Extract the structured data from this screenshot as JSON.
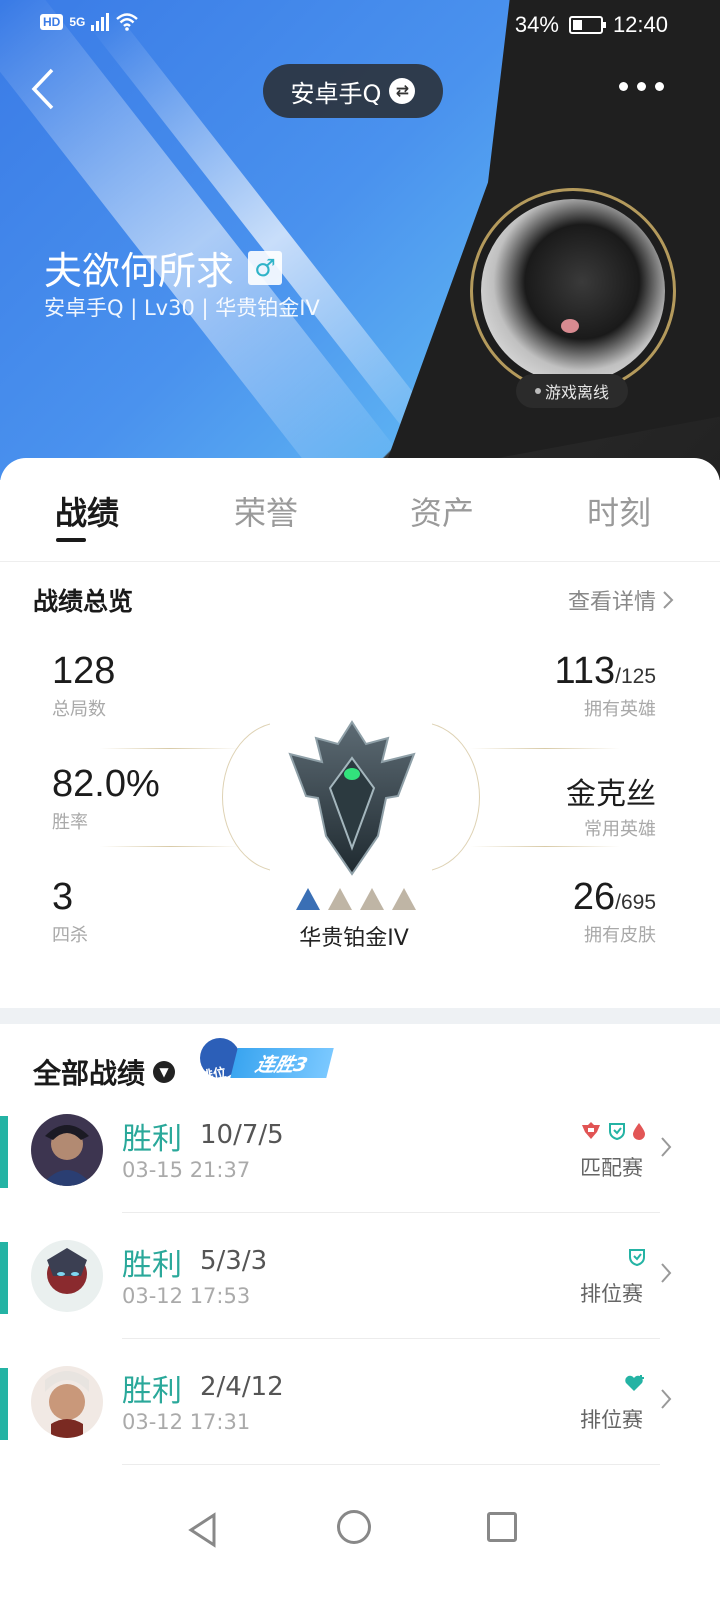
{
  "status_bar": {
    "hd": "HD",
    "network": "5G",
    "battery_percent": "34%",
    "battery_level": 0.34,
    "time": "12:40"
  },
  "header": {
    "account_switch_label": "安卓手Q",
    "nickname": "夫欲何所求",
    "gender_symbol": "♂",
    "sub_info": "安卓手Q | Lv30 | 华贵铂金IV",
    "online_status": "游戏离线"
  },
  "tabs": [
    {
      "label": "战绩",
      "active": true
    },
    {
      "label": "荣誉",
      "active": false
    },
    {
      "label": "资产",
      "active": false
    },
    {
      "label": "时刻",
      "active": false
    }
  ],
  "overview": {
    "title": "战绩总览",
    "detail_link": "查看详情",
    "total_games": {
      "value": "128",
      "label": "总局数"
    },
    "win_rate": {
      "value": "82.0%",
      "label": "胜率"
    },
    "quadra_kills": {
      "value": "3",
      "label": "四杀"
    },
    "heroes_owned": {
      "value": "113",
      "total": "/125",
      "label": "拥有英雄"
    },
    "common_hero": {
      "value": "金克丝",
      "label": "常用英雄"
    },
    "skins_owned": {
      "value": "26",
      "total": "/695",
      "label": "拥有皮肤"
    },
    "rank_name": "华贵铂金IV",
    "rank_stars_filled": 1,
    "rank_stars_total": 4
  },
  "matches": {
    "title": "全部战绩",
    "streak_tag": "排位",
    "streak_label": "连胜3",
    "items": [
      {
        "result": "胜利",
        "kda": "10/7/5",
        "time": "03-15 21:37",
        "mode": "匹配赛",
        "badges": [
          "mvp-badge-icon",
          "shield-badge-icon",
          "blood-drop-icon"
        ]
      },
      {
        "result": "胜利",
        "kda": "5/3/3",
        "time": "03-12 17:53",
        "mode": "排位赛",
        "badges": [
          "shield-badge-icon"
        ]
      },
      {
        "result": "胜利",
        "kda": "2/4/12",
        "time": "03-12 17:31",
        "mode": "排位赛",
        "badges": [
          "heart-plus-icon"
        ]
      }
    ]
  },
  "colors": {
    "accent_teal": "#24b3a4",
    "win_text": "#2aa89a",
    "header_blue": "#3a7be6",
    "header_dark": "#1f1f1f"
  }
}
